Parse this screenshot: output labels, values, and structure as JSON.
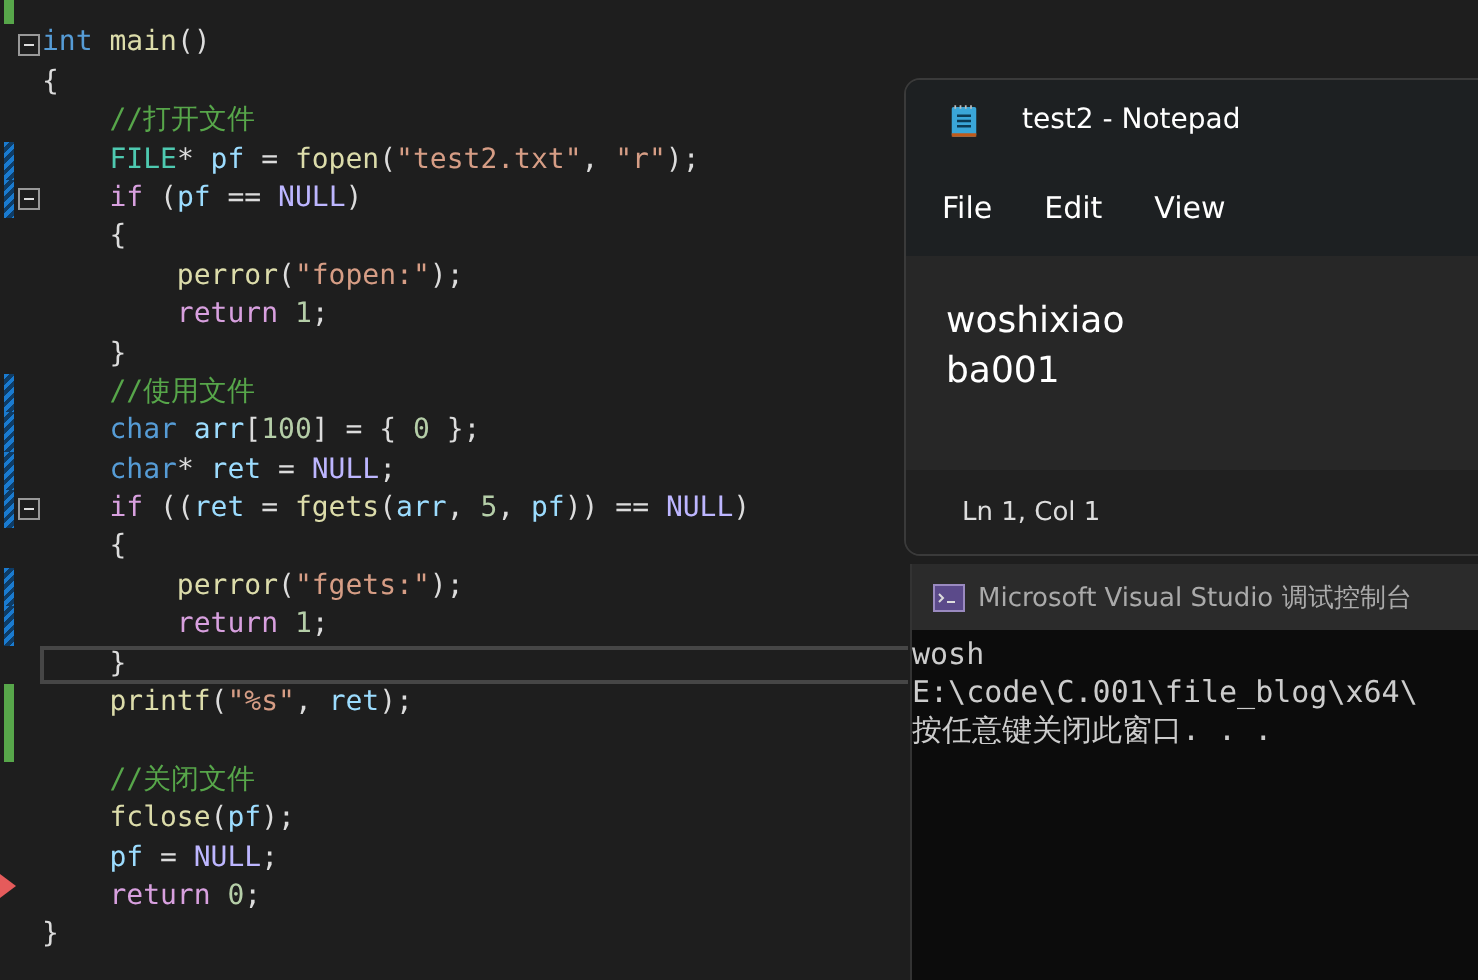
{
  "editor": {
    "lines": [
      {
        "modified": false,
        "saved": true,
        "fold": false,
        "current": false,
        "arrow": false
      },
      {
        "modified": false,
        "saved": false,
        "fold": true,
        "current": false,
        "arrow": false,
        "tokens": [
          {
            "kind": "keyword",
            "text": "int "
          },
          {
            "kind": "function",
            "text": "main"
          },
          {
            "kind": "plain",
            "text": "()"
          }
        ]
      },
      {
        "modified": false,
        "saved": false,
        "fold": false,
        "current": false,
        "arrow": false,
        "tokens": [
          {
            "kind": "plain",
            "text": "{"
          }
        ]
      },
      {
        "modified": false,
        "saved": false,
        "fold": false,
        "current": false,
        "arrow": false,
        "tokens": [
          {
            "kind": "comment",
            "text": "    //打开文件"
          }
        ]
      },
      {
        "modified": true,
        "saved": false,
        "fold": false,
        "current": false,
        "arrow": false,
        "tokens": [
          {
            "kind": "type",
            "text": "    FILE"
          },
          {
            "kind": "plain",
            "text": "* "
          },
          {
            "kind": "variable",
            "text": "pf "
          },
          {
            "kind": "plain",
            "text": "= "
          },
          {
            "kind": "function",
            "text": "fopen"
          },
          {
            "kind": "plain",
            "text": "("
          },
          {
            "kind": "string",
            "text": "\"test2.txt\""
          },
          {
            "kind": "plain",
            "text": ", "
          },
          {
            "kind": "string",
            "text": "\"r\""
          },
          {
            "kind": "plain",
            "text": ");"
          }
        ]
      },
      {
        "modified": true,
        "saved": false,
        "fold": true,
        "current": false,
        "arrow": false,
        "tokens": [
          {
            "kind": "control",
            "text": "    if "
          },
          {
            "kind": "plain",
            "text": "("
          },
          {
            "kind": "variable",
            "text": "pf "
          },
          {
            "kind": "plain",
            "text": "== "
          },
          {
            "kind": "macro",
            "text": "NULL"
          },
          {
            "kind": "plain",
            "text": ")"
          }
        ]
      },
      {
        "modified": false,
        "saved": false,
        "fold": false,
        "current": false,
        "arrow": false,
        "tokens": [
          {
            "kind": "plain",
            "text": "    {"
          }
        ]
      },
      {
        "modified": false,
        "saved": false,
        "fold": false,
        "current": false,
        "arrow": false,
        "tokens": [
          {
            "kind": "function",
            "text": "        perror"
          },
          {
            "kind": "plain",
            "text": "("
          },
          {
            "kind": "string",
            "text": "\"fopen:\""
          },
          {
            "kind": "plain",
            "text": ");"
          }
        ]
      },
      {
        "modified": false,
        "saved": false,
        "fold": false,
        "current": false,
        "arrow": false,
        "tokens": [
          {
            "kind": "control",
            "text": "        return "
          },
          {
            "kind": "number",
            "text": "1"
          },
          {
            "kind": "plain",
            "text": ";"
          }
        ]
      },
      {
        "modified": false,
        "saved": false,
        "fold": false,
        "current": false,
        "arrow": false,
        "tokens": [
          {
            "kind": "plain",
            "text": "    }"
          }
        ]
      },
      {
        "modified": true,
        "saved": false,
        "fold": false,
        "current": false,
        "arrow": false,
        "tokens": [
          {
            "kind": "comment",
            "text": "    //使用文件"
          }
        ]
      },
      {
        "modified": true,
        "saved": false,
        "fold": false,
        "current": false,
        "arrow": false,
        "tokens": [
          {
            "kind": "keyword",
            "text": "    char "
          },
          {
            "kind": "variable",
            "text": "arr"
          },
          {
            "kind": "plain",
            "text": "["
          },
          {
            "kind": "number",
            "text": "100"
          },
          {
            "kind": "plain",
            "text": "] = { "
          },
          {
            "kind": "number",
            "text": "0"
          },
          {
            "kind": "plain",
            "text": " };"
          }
        ]
      },
      {
        "modified": true,
        "saved": false,
        "fold": false,
        "current": false,
        "arrow": false,
        "tokens": [
          {
            "kind": "keyword",
            "text": "    char"
          },
          {
            "kind": "plain",
            "text": "* "
          },
          {
            "kind": "variable",
            "text": "ret "
          },
          {
            "kind": "plain",
            "text": "= "
          },
          {
            "kind": "macro",
            "text": "NULL"
          },
          {
            "kind": "plain",
            "text": ";"
          }
        ]
      },
      {
        "modified": true,
        "saved": false,
        "fold": true,
        "current": false,
        "arrow": false,
        "tokens": [
          {
            "kind": "control",
            "text": "    if "
          },
          {
            "kind": "plain",
            "text": "(("
          },
          {
            "kind": "variable",
            "text": "ret "
          },
          {
            "kind": "plain",
            "text": "= "
          },
          {
            "kind": "function",
            "text": "fgets"
          },
          {
            "kind": "plain",
            "text": "("
          },
          {
            "kind": "variable",
            "text": "arr"
          },
          {
            "kind": "plain",
            "text": ", "
          },
          {
            "kind": "number",
            "text": "5"
          },
          {
            "kind": "plain",
            "text": ", "
          },
          {
            "kind": "variable",
            "text": "pf"
          },
          {
            "kind": "plain",
            "text": ")) == "
          },
          {
            "kind": "macro",
            "text": "NULL"
          },
          {
            "kind": "plain",
            "text": ")"
          }
        ]
      },
      {
        "modified": false,
        "saved": false,
        "fold": false,
        "current": false,
        "arrow": false,
        "tokens": [
          {
            "kind": "plain",
            "text": "    {"
          }
        ]
      },
      {
        "modified": true,
        "saved": false,
        "fold": false,
        "current": false,
        "arrow": false,
        "tokens": [
          {
            "kind": "function",
            "text": "        perror"
          },
          {
            "kind": "plain",
            "text": "("
          },
          {
            "kind": "string",
            "text": "\"fgets:\""
          },
          {
            "kind": "plain",
            "text": ");"
          }
        ]
      },
      {
        "modified": true,
        "saved": false,
        "fold": false,
        "current": false,
        "arrow": false,
        "tokens": [
          {
            "kind": "control",
            "text": "        return "
          },
          {
            "kind": "number",
            "text": "1"
          },
          {
            "kind": "plain",
            "text": ";"
          }
        ]
      },
      {
        "modified": false,
        "saved": false,
        "fold": false,
        "current": true,
        "arrow": false,
        "tokens": [
          {
            "kind": "plain",
            "text": "    }"
          }
        ]
      },
      {
        "modified": false,
        "saved": true,
        "fold": false,
        "current": false,
        "arrow": false,
        "tokens": [
          {
            "kind": "function",
            "text": "    printf"
          },
          {
            "kind": "plain",
            "text": "("
          },
          {
            "kind": "string",
            "text": "\"%s\""
          },
          {
            "kind": "plain",
            "text": ", "
          },
          {
            "kind": "variable",
            "text": "ret"
          },
          {
            "kind": "plain",
            "text": ");"
          }
        ]
      },
      {
        "modified": false,
        "saved": true,
        "fold": false,
        "current": false,
        "arrow": false
      },
      {
        "modified": false,
        "saved": false,
        "fold": false,
        "current": false,
        "arrow": false,
        "tokens": [
          {
            "kind": "comment",
            "text": "    //关闭文件"
          }
        ]
      },
      {
        "modified": false,
        "saved": false,
        "fold": false,
        "current": false,
        "arrow": false,
        "tokens": [
          {
            "kind": "function",
            "text": "    fclose"
          },
          {
            "kind": "plain",
            "text": "("
          },
          {
            "kind": "variable",
            "text": "pf"
          },
          {
            "kind": "plain",
            "text": ");"
          }
        ]
      },
      {
        "modified": false,
        "saved": false,
        "fold": false,
        "current": false,
        "arrow": false,
        "tokens": [
          {
            "kind": "variable",
            "text": "    pf "
          },
          {
            "kind": "plain",
            "text": "= "
          },
          {
            "kind": "macro",
            "text": "NULL"
          },
          {
            "kind": "plain",
            "text": ";"
          }
        ]
      },
      {
        "modified": false,
        "saved": false,
        "fold": false,
        "current": false,
        "arrow": true,
        "tokens": [
          {
            "kind": "control",
            "text": "    return "
          },
          {
            "kind": "number",
            "text": "0"
          },
          {
            "kind": "plain",
            "text": ";"
          }
        ]
      },
      {
        "modified": false,
        "saved": false,
        "fold": false,
        "current": false,
        "arrow": false,
        "tokens": [
          {
            "kind": "plain",
            "text": "}"
          }
        ]
      }
    ]
  },
  "notepad": {
    "title": "test2 - Notepad",
    "menu": [
      "File",
      "Edit",
      "View"
    ],
    "content": [
      "woshixiao",
      "ba001"
    ],
    "status": "Ln 1, Col 1"
  },
  "console": {
    "title": "Microsoft Visual Studio 调试控制台",
    "output": [
      "wosh",
      "E:\\code\\C.001\\file_blog\\x64\\",
      "按任意键关闭此窗口. . ."
    ]
  }
}
